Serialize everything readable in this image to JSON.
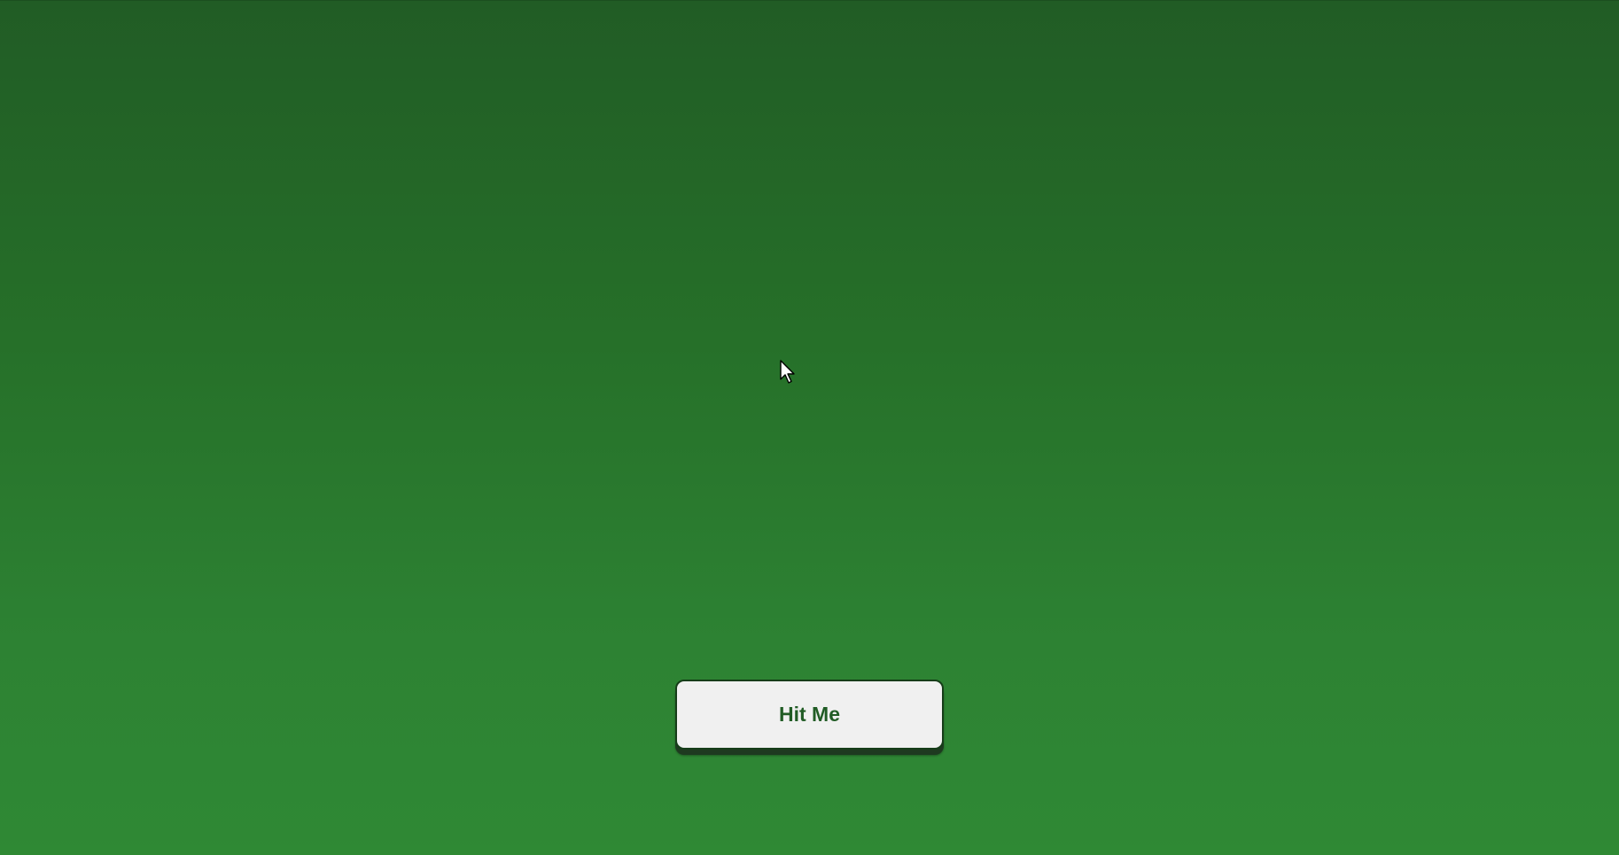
{
  "game": {
    "hit_button_label": "Hit Me"
  },
  "colors": {
    "felt_top": "#215c25",
    "felt_bottom": "#2f8934",
    "button_background": "#f0f0f0",
    "button_text": "#215c25"
  },
  "icons": {
    "cursor": "mouse-pointer-icon"
  }
}
